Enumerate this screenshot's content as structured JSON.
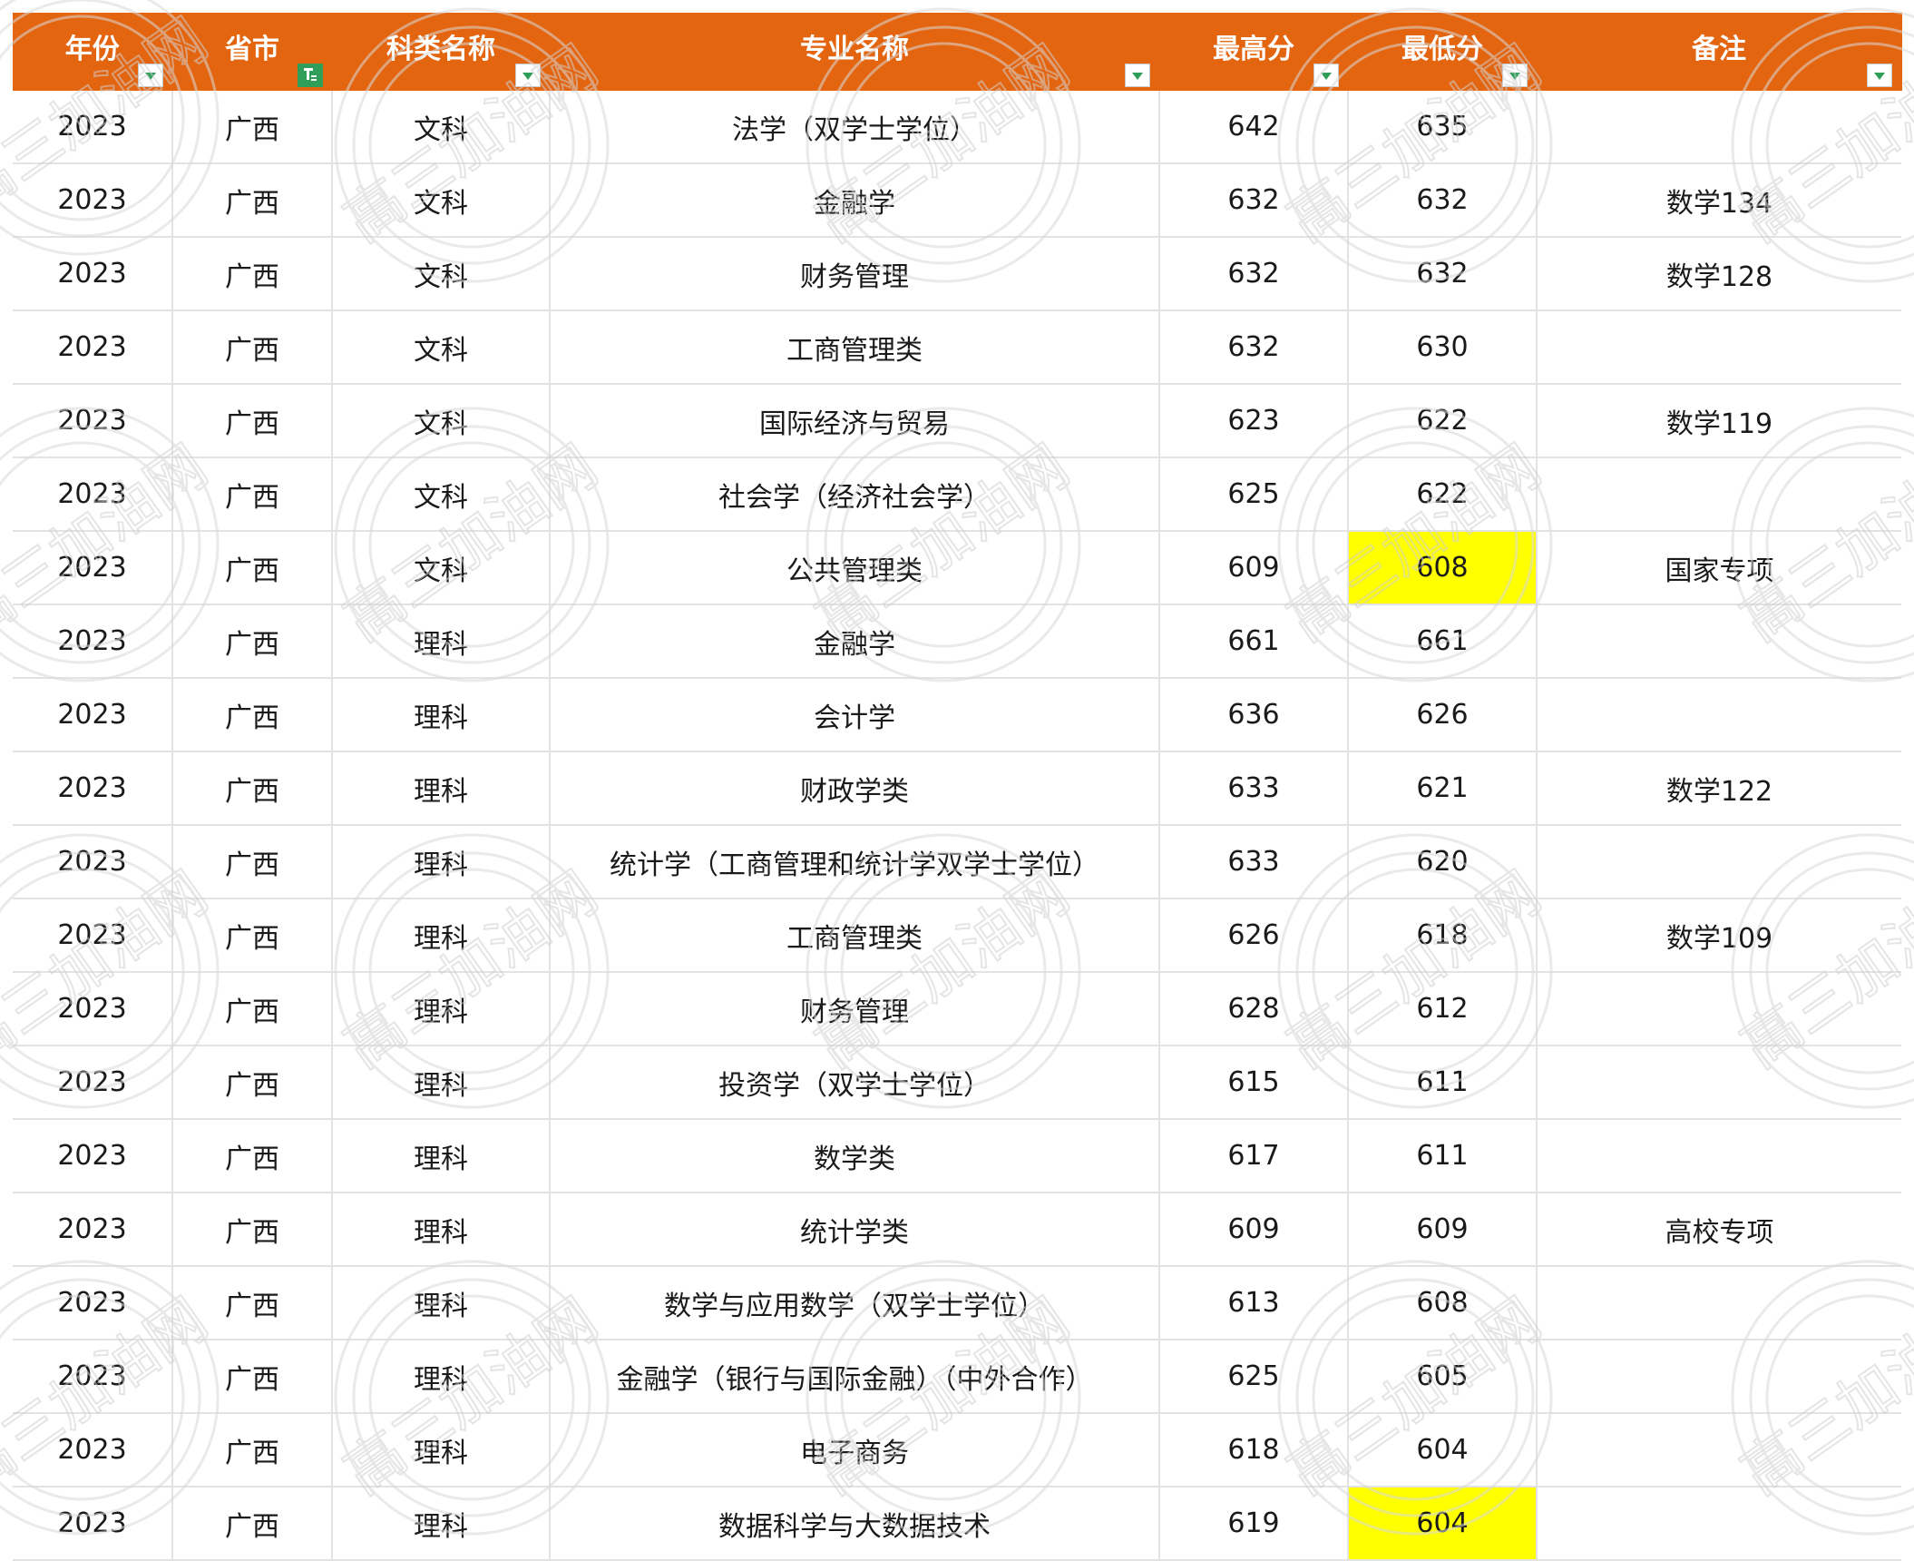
{
  "headers": {
    "year": "年份",
    "province": "省市",
    "category": "科类名称",
    "major": "专业名称",
    "max_score": "最高分",
    "min_score": "最低分",
    "note": "备注"
  },
  "filter_state": {
    "province_filter_active": true
  },
  "highlight_color": "#ffff00",
  "header_color": "#e46510",
  "watermark_text": "高三加油网",
  "rows": [
    {
      "year": "2023",
      "province": "广西",
      "category": "文科",
      "major": "法学（双学士学位）",
      "max": "642",
      "min": "635",
      "note": "",
      "min_highlight": false
    },
    {
      "year": "2023",
      "province": "广西",
      "category": "文科",
      "major": "金融学",
      "max": "632",
      "min": "632",
      "note": "数学134",
      "min_highlight": false
    },
    {
      "year": "2023",
      "province": "广西",
      "category": "文科",
      "major": "财务管理",
      "max": "632",
      "min": "632",
      "note": "数学128",
      "min_highlight": false
    },
    {
      "year": "2023",
      "province": "广西",
      "category": "文科",
      "major": "工商管理类",
      "max": "632",
      "min": "630",
      "note": "",
      "min_highlight": false
    },
    {
      "year": "2023",
      "province": "广西",
      "category": "文科",
      "major": "国际经济与贸易",
      "max": "623",
      "min": "622",
      "note": "数学119",
      "min_highlight": false
    },
    {
      "year": "2023",
      "province": "广西",
      "category": "文科",
      "major": "社会学（经济社会学）",
      "max": "625",
      "min": "622",
      "note": "",
      "min_highlight": false
    },
    {
      "year": "2023",
      "province": "广西",
      "category": "文科",
      "major": "公共管理类",
      "max": "609",
      "min": "608",
      "note": "国家专项",
      "min_highlight": true
    },
    {
      "year": "2023",
      "province": "广西",
      "category": "理科",
      "major": "金融学",
      "max": "661",
      "min": "661",
      "note": "",
      "min_highlight": false
    },
    {
      "year": "2023",
      "province": "广西",
      "category": "理科",
      "major": "会计学",
      "max": "636",
      "min": "626",
      "note": "",
      "min_highlight": false
    },
    {
      "year": "2023",
      "province": "广西",
      "category": "理科",
      "major": "财政学类",
      "max": "633",
      "min": "621",
      "note": "数学122",
      "min_highlight": false
    },
    {
      "year": "2023",
      "province": "广西",
      "category": "理科",
      "major": "统计学（工商管理和统计学双学士学位）",
      "max": "633",
      "min": "620",
      "note": "",
      "min_highlight": false
    },
    {
      "year": "2023",
      "province": "广西",
      "category": "理科",
      "major": "工商管理类",
      "max": "626",
      "min": "618",
      "note": "数学109",
      "min_highlight": false
    },
    {
      "year": "2023",
      "province": "广西",
      "category": "理科",
      "major": "财务管理",
      "max": "628",
      "min": "612",
      "note": "",
      "min_highlight": false
    },
    {
      "year": "2023",
      "province": "广西",
      "category": "理科",
      "major": "投资学（双学士学位）",
      "max": "615",
      "min": "611",
      "note": "",
      "min_highlight": false
    },
    {
      "year": "2023",
      "province": "广西",
      "category": "理科",
      "major": "数学类",
      "max": "617",
      "min": "611",
      "note": "",
      "min_highlight": false
    },
    {
      "year": "2023",
      "province": "广西",
      "category": "理科",
      "major": "统计学类",
      "max": "609",
      "min": "609",
      "note": "高校专项",
      "min_highlight": false
    },
    {
      "year": "2023",
      "province": "广西",
      "category": "理科",
      "major": "数学与应用数学（双学士学位）",
      "max": "613",
      "min": "608",
      "note": "",
      "min_highlight": false
    },
    {
      "year": "2023",
      "province": "广西",
      "category": "理科",
      "major": "金融学（银行与国际金融）（中外合作）",
      "max": "625",
      "min": "605",
      "note": "",
      "min_highlight": false
    },
    {
      "year": "2023",
      "province": "广西",
      "category": "理科",
      "major": "电子商务",
      "max": "618",
      "min": "604",
      "note": "",
      "min_highlight": false
    },
    {
      "year": "2023",
      "province": "广西",
      "category": "理科",
      "major": "数据科学与大数据技术",
      "max": "619",
      "min": "604",
      "note": "",
      "min_highlight": true
    }
  ]
}
